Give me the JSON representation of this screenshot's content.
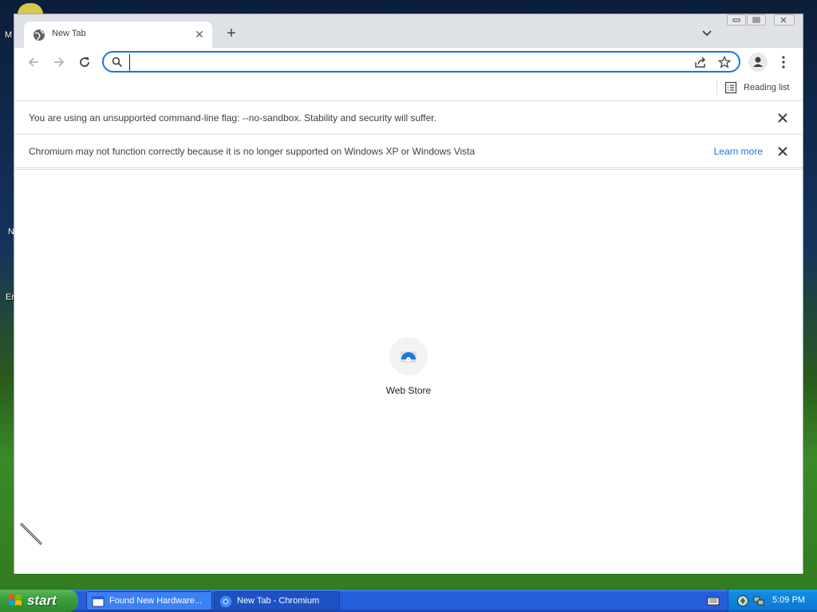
{
  "desktop": {
    "icons": [
      {
        "label": "M"
      },
      {
        "label": "N"
      },
      {
        "label": "Er"
      }
    ]
  },
  "browser": {
    "tab": {
      "title": "New Tab",
      "favicon": "globe-icon"
    },
    "omnibox": {
      "value": "",
      "placeholder": ""
    },
    "bookmarks": {
      "reading_list": "Reading list"
    },
    "infobars": [
      {
        "text": "You are using an unsupported command-line flag: --no-sandbox. Stability and security will suffer.",
        "link": ""
      },
      {
        "text": "Chromium may not function correctly because it is no longer supported on Windows XP or Windows Vista",
        "link": "Learn more"
      }
    ],
    "shortcut": {
      "label": "Web Store",
      "icon": "web-store-icon"
    },
    "accent_color": "#1a73e8"
  },
  "taskbar": {
    "start_label": "start",
    "tasks": [
      {
        "label": "Found New Hardware...",
        "active": false
      },
      {
        "label": "New Tab - Chromium",
        "active": true
      }
    ],
    "clock": "5:09 PM"
  }
}
